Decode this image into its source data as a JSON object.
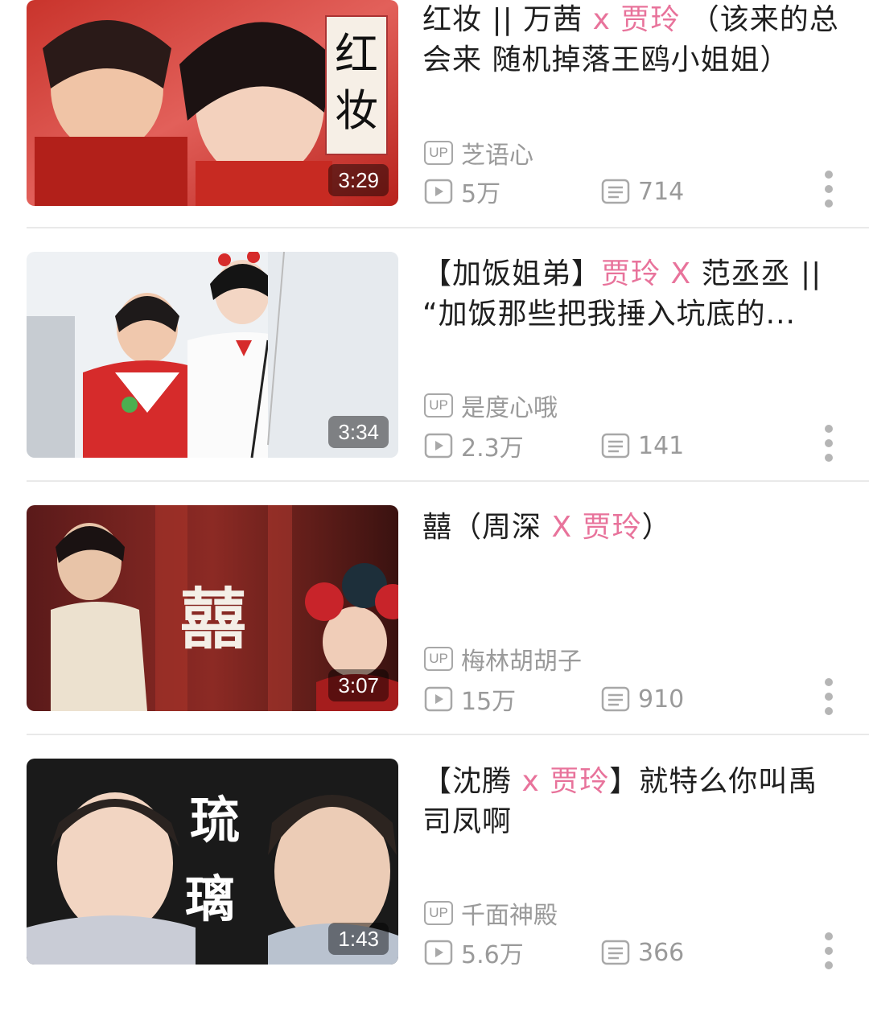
{
  "colors": {
    "highlight": "#e8739b",
    "title": "#1f1f1f",
    "meta": "#9a9a9a",
    "divider": "#e9e9e9"
  },
  "videos": [
    {
      "title_parts": [
        {
          "text": "红妆 || 万茜 ",
          "hl": false
        },
        {
          "text": "x 贾玲",
          "hl": true
        },
        {
          "text": " （该来的总会来  随机掉落王鸥小姐姐）",
          "hl": false
        }
      ],
      "thumb_text": "红\n妆",
      "duration": "3:29",
      "up_badge": "UP",
      "uploader": "芝语心",
      "plays": "5万",
      "danmaku": "714"
    },
    {
      "title_parts": [
        {
          "text": "【加饭姐弟】",
          "hl": false
        },
        {
          "text": "贾玲 X ",
          "hl": true
        },
        {
          "text": "范丞丞 || “加饭那些把我捶入坑底的...",
          "hl": false
        }
      ],
      "thumb_text": "",
      "duration": "3:34",
      "up_badge": "UP",
      "uploader": "是度心哦",
      "plays": "2.3万",
      "danmaku": "141"
    },
    {
      "title_parts": [
        {
          "text": "囍（周深 ",
          "hl": false
        },
        {
          "text": "X 贾玲",
          "hl": true
        },
        {
          "text": "）",
          "hl": false
        }
      ],
      "thumb_text": "囍",
      "duration": "3:07",
      "up_badge": "UP",
      "uploader": "梅林胡胡子",
      "plays": "15万",
      "danmaku": "910"
    },
    {
      "title_parts": [
        {
          "text": "【沈腾 ",
          "hl": false
        },
        {
          "text": "x 贾玲",
          "hl": true
        },
        {
          "text": "】就特么你叫禹司凤啊",
          "hl": false
        }
      ],
      "thumb_text": "琉\n璃",
      "duration": "1:43",
      "up_badge": "UP",
      "uploader": "千面神殿",
      "plays": "5.6万",
      "danmaku": "366"
    }
  ],
  "icons": {
    "up": "up-badge-icon",
    "plays": "play-count-icon",
    "danmaku": "danmaku-icon",
    "more": "more-vertical-icon"
  }
}
